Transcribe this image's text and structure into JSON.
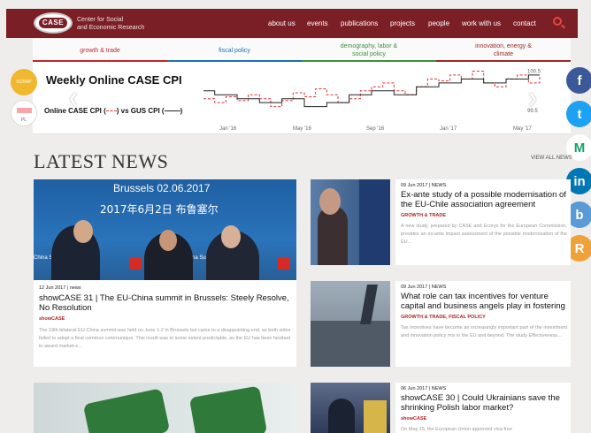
{
  "brand": {
    "logo_text": "CASE",
    "line1": "Center for Social",
    "line2": "and Economic Research"
  },
  "nav": [
    "about us",
    "events",
    "publications",
    "projects",
    "people",
    "work with us",
    "contact"
  ],
  "categories": [
    {
      "label": "growth & trade",
      "color": "#c0262c"
    },
    {
      "label": "fiscal policy",
      "color": "#1e6fb5"
    },
    {
      "label": "demography, labor & social policy",
      "color": "#3e8e3e"
    },
    {
      "label": "innovation, energy & climate",
      "color": "#9a2a2a"
    }
  ],
  "banner": {
    "title": "Weekly Online CASE CPI",
    "legend_a": "Online CASE CPI (",
    "legend_mid": ") vs GUS CPI (",
    "legend_end": ")",
    "badge_top": "SCRAP",
    "badge_bottom": "PL"
  },
  "chart_data": {
    "type": "line",
    "title": "",
    "x_ticks": [
      "Jan '16",
      "May '16",
      "Sep '16",
      "Jan '17",
      "May '17"
    ],
    "y_ticks": [
      "100.5",
      "99.5"
    ],
    "ylim": [
      99.3,
      100.6
    ],
    "series": [
      {
        "style": "dashed",
        "color": "#d33",
        "values": [
          99.8,
          99.7,
          99.85,
          99.75,
          99.9,
          99.8,
          99.6,
          99.75,
          99.95,
          99.85,
          100.05,
          99.9,
          99.7,
          99.8,
          100.0,
          100.1,
          100.2,
          100.0,
          99.9,
          100.1,
          100.3,
          100.25,
          100.4,
          100.3,
          100.5,
          100.2,
          100.1,
          100.3,
          100.4,
          100.2,
          100.35
        ]
      },
      {
        "style": "solid",
        "color": "#222",
        "values": [
          100.0,
          99.9,
          99.9,
          99.8,
          99.8,
          99.7,
          99.7,
          99.8,
          99.8,
          99.6,
          99.6,
          99.7,
          99.7,
          99.9,
          99.9,
          100.0,
          100.0,
          99.9,
          99.9,
          100.1,
          100.1,
          100.2,
          100.2,
          100.3,
          100.3,
          100.2,
          100.2,
          100.3,
          100.3,
          100.4,
          100.4
        ]
      }
    ]
  },
  "social": [
    {
      "name": "facebook-icon",
      "glyph": "f",
      "color": "#3b5998"
    },
    {
      "name": "twitter-icon",
      "glyph": "t",
      "color": "#1da1f2"
    },
    {
      "name": "medium-icon",
      "glyph": "M",
      "color": "#ffffff"
    },
    {
      "name": "linkedin-icon",
      "glyph": "in",
      "color": "#0077b5"
    },
    {
      "name": "blogger-icon",
      "glyph": "b",
      "color": "#5a9bd5"
    },
    {
      "name": "rss-icon",
      "glyph": "R",
      "color": "#f0a23a"
    }
  ],
  "latest": {
    "title": "LATEST NEWS",
    "view_all": "VIEW ALL NEWS"
  },
  "feature": {
    "image_line1": "Brussels 02.06.2017",
    "image_line2": "2017年6月2日 布鲁塞尔",
    "image_left": "China Sum",
    "image_right": "China Summ",
    "meta": "12 Jun 2017 | news",
    "headline": "showCASE 31 | The EU-China summit in Brussels: Steely Resolve, No Resolution",
    "tag": "showCASE",
    "excerpt": "The 19th bilateral EU-China summit was held on June 1-2 in Brussels but came to a disappointing end, as both sides failed to adopt a final common communique. This result was to some extent predictable, as the EU has been hesitant to award market-e..."
  },
  "news": [
    {
      "meta": "09 Jun 2017 | NEWS",
      "headline": "Ex-ante study of a possible modernisation of the EU-Chile association agreement",
      "tag": "GROWTH & TRADE",
      "excerpt": "A new study, prepared by CASE and Ecorys for the European Commission, provides an ex-ante impact assessment of the possible modernisation of the EU..."
    },
    {
      "meta": "09 Jun 2017 | NEWS",
      "headline": "What role can tax incentives for venture capital and business angels play in fostering",
      "tag": "GROWTH & TRADE, FISCAL POLICY",
      "excerpt": "Tax incentives have become an increasingly important part of the investment and innovation policy mix in the EU and beyond. The study Effectiveness..."
    },
    {
      "meta": "06 Jun 2017 | NEWS",
      "headline": "showCASE 30 | Could Ukrainians save the shrinking Polish labor market?",
      "tag": "showCASE",
      "excerpt": "On May 15, the European Union approved visa-free"
    }
  ]
}
